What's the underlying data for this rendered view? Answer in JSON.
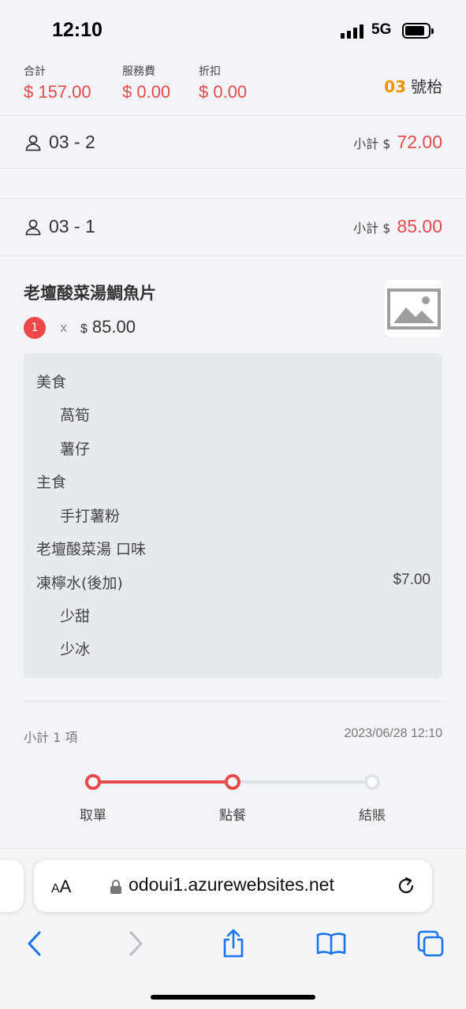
{
  "status_bar": {
    "time": "12:10",
    "network": "5G"
  },
  "summary": {
    "total_label": "合計",
    "total_value": "$ 157.00",
    "service_label": "服務費",
    "service_value": "$ 0.00",
    "discount_label": "折扣",
    "discount_value": "$ 0.00",
    "table_number": "03",
    "table_suffix": "號枱"
  },
  "persons": [
    {
      "name": "03 - 2",
      "subtotal_label": "小計 $",
      "subtotal_value": "72.00"
    },
    {
      "name": "03 - 1",
      "subtotal_label": "小計 $",
      "subtotal_value": "85.00"
    }
  ],
  "item": {
    "name": "老壇酸菜湯鯛魚片",
    "quantity": "1",
    "times": "x",
    "currency": "$",
    "price": "85.00",
    "image_icon": "image-placeholder-icon",
    "options": [
      {
        "text": "美食",
        "indent": false
      },
      {
        "text": "萵筍",
        "indent": true
      },
      {
        "text": "薯仔",
        "indent": true
      },
      {
        "text": "主食",
        "indent": false
      },
      {
        "text": "手打薯粉",
        "indent": true
      },
      {
        "text": "老壇酸菜湯 口味",
        "indent": false
      },
      {
        "text": "凍檸水(後加)",
        "indent": false,
        "price": "$7.00"
      },
      {
        "text": "少甜",
        "indent": true
      },
      {
        "text": "少冰",
        "indent": true
      }
    ]
  },
  "footer": {
    "count_text": "小計 1 項",
    "timestamp": "2023/06/28 12:10"
  },
  "progress": {
    "steps": [
      "取單",
      "點餐",
      "結賬"
    ],
    "completed": 2,
    "active_color": "#e8494a",
    "inactive_color": "#dfe3e7"
  },
  "browser": {
    "aa": "AA",
    "url": "odoui1.azurewebsites.net"
  }
}
